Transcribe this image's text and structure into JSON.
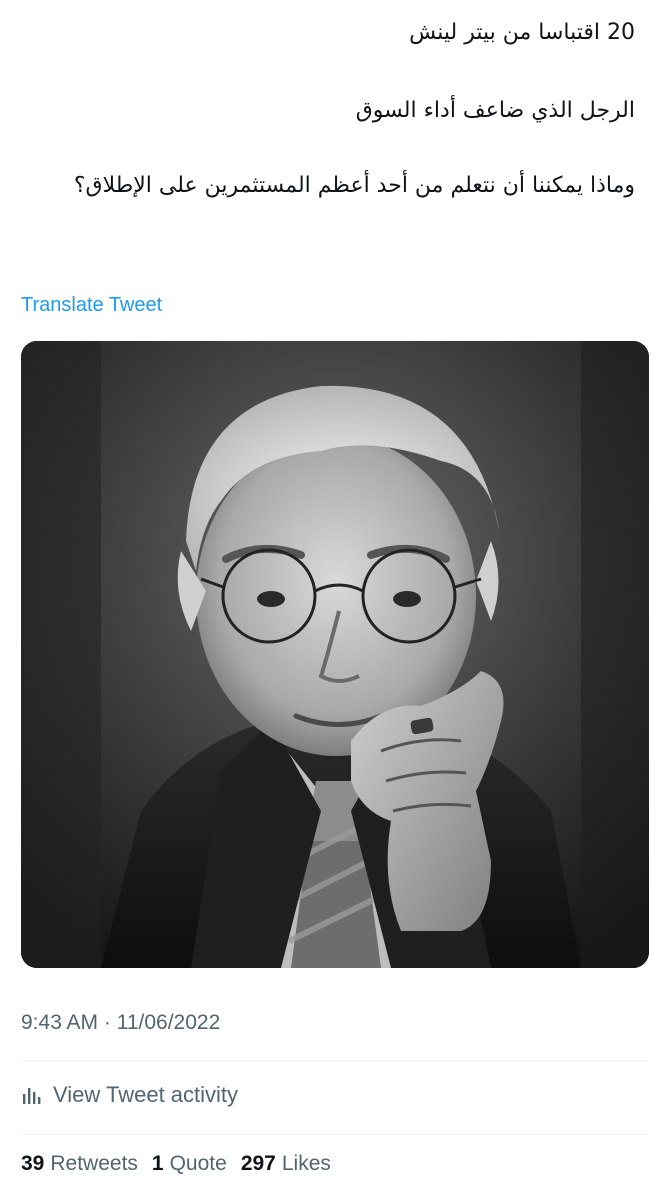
{
  "tweet": {
    "lines": [
      "20 اقتباسا من بيتر لينش",
      "الرجل الذي ضاعف أداء السوق",
      "وماذا يمكننا أن نتعلم من أحد أعظم المستثمرين على الإطلاق؟"
    ],
    "translate_label": "Translate Tweet",
    "timestamp": "9:43 AM · 11/06/2022"
  },
  "activity": {
    "label": "View Tweet activity",
    "icon": "bar-chart-icon"
  },
  "stats": {
    "retweets_count": "39",
    "retweets_label": "Retweets",
    "quotes_count": "1",
    "quotes_label": "Quote",
    "likes_count": "297",
    "likes_label": "Likes"
  },
  "colors": {
    "link": "#1d9bf0",
    "secondary_text": "#536471",
    "primary_text": "#0f1419",
    "divider": "#eff3f4"
  }
}
